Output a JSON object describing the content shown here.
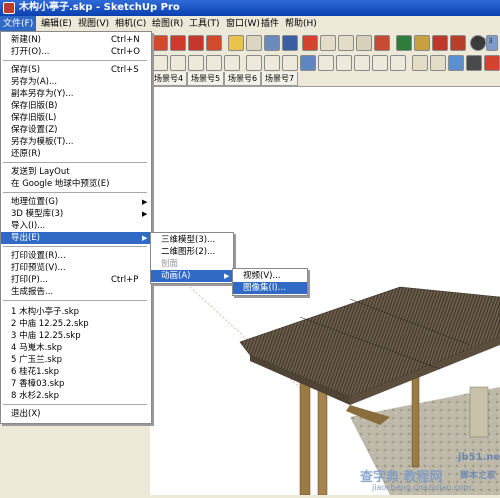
{
  "window": {
    "title": "木构小亭子.skp - SketchUp Pro"
  },
  "menubar": {
    "items": [
      "文件(F)",
      "编辑(E)",
      "视图(V)",
      "相机(C)",
      "绘图(R)",
      "工具(T)",
      "窗口(W)",
      "插件",
      "帮助(H)"
    ]
  },
  "scene_tabs": [
    "场景号4",
    "场景号5",
    "场景号6",
    "场景号7"
  ],
  "file_menu": {
    "items": [
      {
        "label": "新建(N)",
        "shortcut": "Ctrl+N"
      },
      {
        "label": "打开(O)...",
        "shortcut": "Ctrl+O"
      },
      {
        "label": "保存(S)",
        "shortcut": "Ctrl+S"
      },
      {
        "label": "另存为(A)..."
      },
      {
        "label": "副本另存为(Y)..."
      },
      {
        "label": "保存旧版(B)"
      },
      {
        "label": "保存旧版(L)"
      },
      {
        "label": "保存设置(Z)"
      },
      {
        "label": "另存为模板(T)..."
      },
      {
        "label": "还原(R)"
      },
      {
        "label": "发送到 LayOut"
      },
      {
        "label": "在 Google 地球中预览(E)"
      },
      {
        "label": "地理位置(G)"
      },
      {
        "label": "3D 模型库(3)"
      },
      {
        "label": "导入(I)..."
      },
      {
        "label": "导出(E)"
      },
      {
        "label": "打印设置(R)..."
      },
      {
        "label": "打印预览(V)..."
      },
      {
        "label": "打印(P)...",
        "shortcut": "Ctrl+P"
      },
      {
        "label": "生成报告..."
      },
      {
        "label": "1 木构小亭子.skp"
      },
      {
        "label": "2 中庙 12.25.2.skp"
      },
      {
        "label": "3 中庙 12.25.skp"
      },
      {
        "label": "4 马嵬木.skp"
      },
      {
        "label": "5 广玉兰.skp"
      },
      {
        "label": "6 桂花1.skp"
      },
      {
        "label": "7 香樟03.skp"
      },
      {
        "label": "8 水杉2.skp"
      },
      {
        "label": "退出(X)"
      }
    ]
  },
  "export_menu": {
    "items": [
      {
        "label": "三维模型(3)..."
      },
      {
        "label": "二维图形(2)..."
      },
      {
        "label": "剖面"
      },
      {
        "label": "动画(A)"
      }
    ]
  },
  "animation_menu": {
    "items": [
      {
        "label": "视频(V)..."
      },
      {
        "label": "图像集(I)..."
      }
    ]
  },
  "toolbar": {
    "layer_label": "1 2 3"
  },
  "watermark": {
    "cn": "查字典 教程网",
    "domain": "jiaocheng.chazidian.com",
    "site": "jb51.net",
    "site_cn": "脚本之家"
  }
}
